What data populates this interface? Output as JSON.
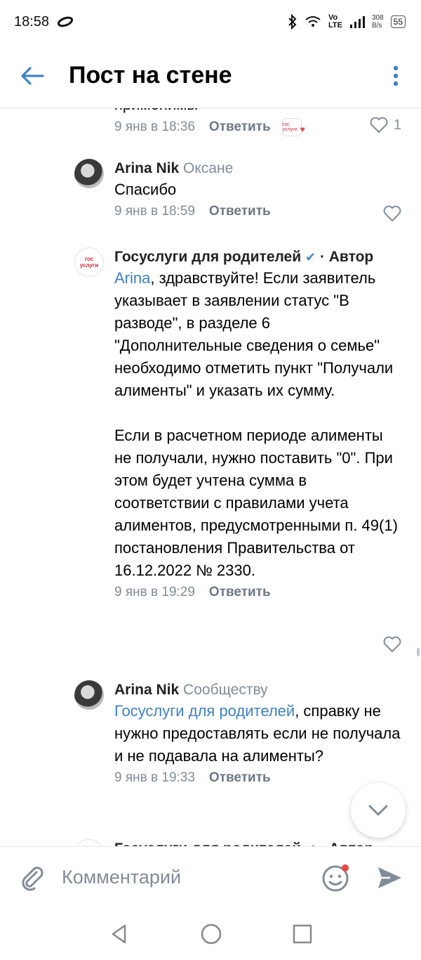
{
  "status": {
    "time": "18:58",
    "lte_top": "Vo",
    "lte_bottom": "LTE",
    "speed_value": "308",
    "speed_unit": "B/s",
    "battery": "55"
  },
  "header": {
    "title": "Пост на стене"
  },
  "cut_text": "применимы",
  "comments": [
    {
      "date": "9 янв в 18:36",
      "reply_label": "Ответить",
      "likes": "1",
      "reaction_label": "гос услуги"
    },
    {
      "author": "Arina Nik",
      "reply_to": "Оксане",
      "text": "Спасибо",
      "date": "9 янв в 18:59",
      "reply_label": "Ответить"
    },
    {
      "author": "Госуслуги для родителей",
      "badge": "· Автор",
      "avatar_label": "гос услуги",
      "mention": "Arina",
      "text_p1": ", здравствуйте! Если заявитель указывает в заявлении статус \"В разводе\", в разделе 6 \"Дополнительные сведения о семье\" необходимо отметить пункт \"Получали алименты\" и указать их сумму.",
      "text_p2": "Если в расчетном периоде алименты не получали, нужно поставить \"0\". При этом будет учтена сумма в соответствии с правилами учета алиментов, предусмотренными п. 49(1) постановления Правительства от 16.12.2022 № 2330.",
      "date": "9 янв в 19:29",
      "reply_label": "Ответить"
    },
    {
      "author": "Arina Nik",
      "reply_to": "Сообществу",
      "mention": "Госуслуги для родителей",
      "text": ", справку не нужно предоставлять если не получала и не подавала на алименты?",
      "date": "9 янв в 19:33",
      "reply_label": "Ответить"
    },
    {
      "author": "Госуслуги для родителей",
      "badge": "· Автор"
    }
  ],
  "composer": {
    "placeholder": "Комментарий"
  },
  "colors": {
    "accent": "#3f82c4",
    "muted": "#818c99",
    "reaction_heart": "#e64646"
  },
  "icons": [
    "back-arrow-icon",
    "more-vertical-icon",
    "heart-icon",
    "attach-icon",
    "emoji-icon",
    "send-icon",
    "chevron-down-icon",
    "nav-back-icon",
    "nav-home-icon",
    "nav-recents-icon"
  ]
}
